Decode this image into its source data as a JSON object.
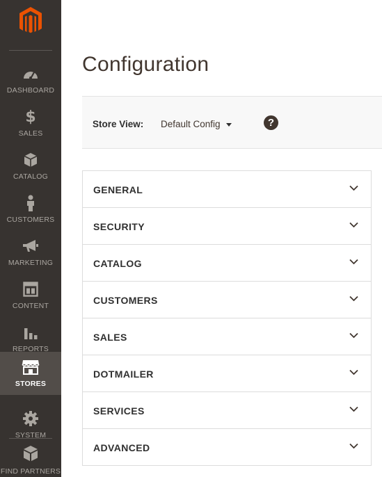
{
  "sidebar": {
    "items": [
      {
        "label": "DASHBOARD",
        "icon": "dashboard-icon"
      },
      {
        "label": "SALES",
        "icon": "dollar-icon"
      },
      {
        "label": "CATALOG",
        "icon": "box-icon"
      },
      {
        "label": "CUSTOMERS",
        "icon": "person-icon"
      },
      {
        "label": "MARKETING",
        "icon": "megaphone-icon"
      },
      {
        "label": "CONTENT",
        "icon": "layout-icon"
      },
      {
        "label": "REPORTS",
        "icon": "bar-chart-icon"
      },
      {
        "label": "STORES",
        "icon": "storefront-icon",
        "active": true
      },
      {
        "label": "SYSTEM",
        "icon": "gear-icon"
      },
      {
        "label": "FIND PARTNERS & EXTENSIONS",
        "icon": "blocks-icon"
      }
    ]
  },
  "page": {
    "title": "Configuration"
  },
  "store_view": {
    "label": "Store View:",
    "value": "Default Config",
    "help_glyph": "?"
  },
  "sections": [
    {
      "title": "GENERAL"
    },
    {
      "title": "SECURITY"
    },
    {
      "title": "CATALOG"
    },
    {
      "title": "CUSTOMERS"
    },
    {
      "title": "SALES"
    },
    {
      "title": "DOTMAILER"
    },
    {
      "title": "SERVICES"
    },
    {
      "title": "ADVANCED"
    }
  ],
  "colors": {
    "sidebar_bg": "#373330",
    "sidebar_active_bg": "#524d49",
    "logo_orange": "#eb5202",
    "text_dark": "#303030"
  }
}
